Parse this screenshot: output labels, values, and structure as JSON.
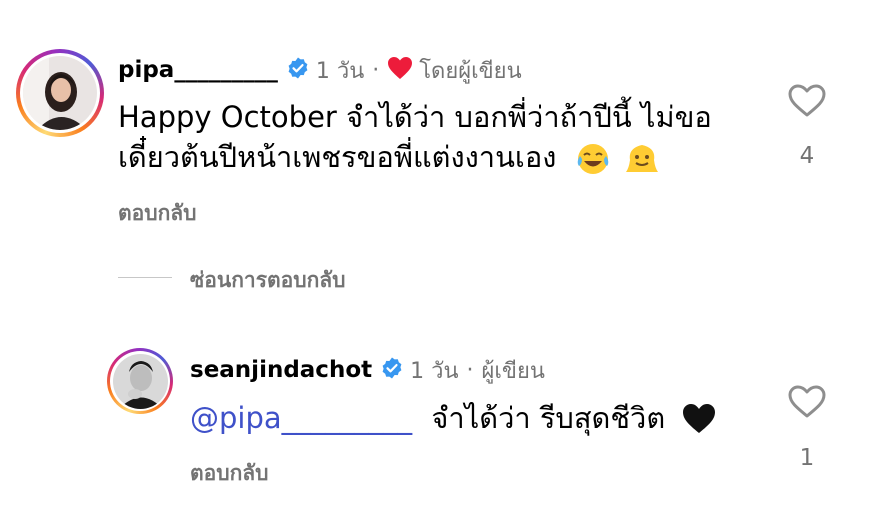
{
  "comments": [
    {
      "username": "pipa_________",
      "time": "1 วัน",
      "sep": "·",
      "author_like_label": "โดยผู้เขียน",
      "text_line1": "Happy October จำได้ว่า บอกพี่ว่าถ้าปีนี้ ไม่ขอ",
      "text_line2": "เดี๋ยวต้นปีหน้าเพชรขอพี่แต่งงานเอง",
      "emojis": [
        "face-with-tears-of-joy-emoji",
        "melting-face-emoji"
      ],
      "reply_label": "ตอบกลับ",
      "like_count": "4"
    },
    {
      "username": "seanjindachot",
      "time": "1 วัน",
      "sep": "·",
      "author_label": "ผู้เขียน",
      "mention": "@pipa_________",
      "text": "จำได้ว่า รีบสุดชีวิต",
      "emojis": [
        "black-heart-emoji"
      ],
      "reply_label": "ตอบกลับ",
      "like_count": "1"
    }
  ],
  "hide_replies_label": "ซ่อนการตอบกลับ",
  "colors": {
    "verified": "#3897f0",
    "heart": "#ed1c3b",
    "mention": "#3f51c9",
    "meta": "#737373"
  }
}
